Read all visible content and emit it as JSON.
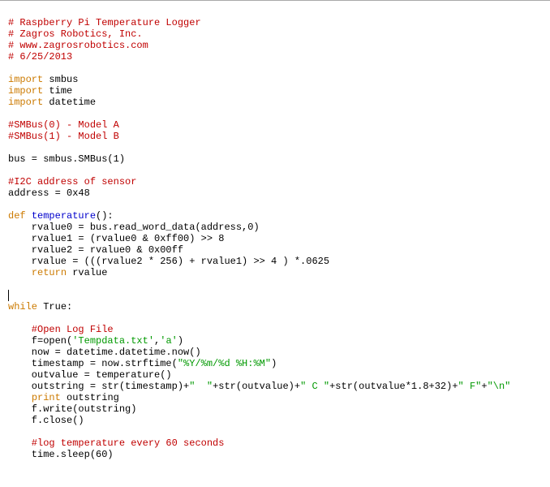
{
  "code": {
    "hdr1": "# Raspberry Pi Temperature Logger",
    "hdr2": "# Zagros Robotics, Inc.",
    "hdr3": "# www.zagrosrobotics.com",
    "hdr4": "# 6/25/2013",
    "kw_import": "import",
    "mod_smbus": "smbus",
    "mod_time": "time",
    "mod_datetime": "datetime",
    "cm_smbus0": "#SMBus(0) - Model A",
    "cm_smbus1": "#SMBus(1) - Model B",
    "tok_bus": "bus = smbus.SMBus(1)",
    "cm_i2c": "#I2C address of sensor",
    "tok_addr": "address = 0x48",
    "kw_def": "def",
    "fn_name": "temperature",
    "fn_sig_tail": "():",
    "tok_rv0": "    rvalue0 = bus.read_word_data(address,0)",
    "tok_rv1": "    rvalue1 = (rvalue0 & 0xff00) >> 8",
    "tok_rv2": "    rvalue2 = rvalue0 & 0x00ff",
    "tok_rv": "    rvalue = (((rvalue2 * 256) + rvalue1) >> 4 ) *.0625",
    "kw_return": "return",
    "tok_return_tail": " rvalue",
    "indent4": "    ",
    "kw_while": "while",
    "tok_true": " True:",
    "cm_open": "    #Open Log File",
    "tok_fopen_a": "    f=open(",
    "str_tempdata": "'Tempdata.txt'",
    "tok_comma": ",",
    "str_a": "'a'",
    "tok_close_paren": ")",
    "tok_now": "    now = datetime.datetime.now()",
    "tok_ts_a": "    timestamp = now.strftime(",
    "str_fmt": "\"%Y/%m/%d %H:%M\"",
    "tok_ts_b": ")",
    "tok_outval": "    outvalue = temperature()",
    "tok_os_a": "    outstring = str(timestamp)+",
    "str_sp1": "\"  \"",
    "tok_os_b": "+str(outvalue)+",
    "str_c": "\" C \"",
    "tok_os_c": "+str(outvalue*1.8+32)+",
    "str_f": "\" F\"",
    "tok_os_d": "+",
    "str_nl": "\"\\n\"",
    "kw_print": "print",
    "tok_print_tail": " outstring",
    "tok_fwrite": "    f.write(outstring)",
    "tok_fclose": "    f.close()",
    "cm_log": "    #log temperature every 60 seconds",
    "tok_sleep": "    time.sleep(60)"
  }
}
